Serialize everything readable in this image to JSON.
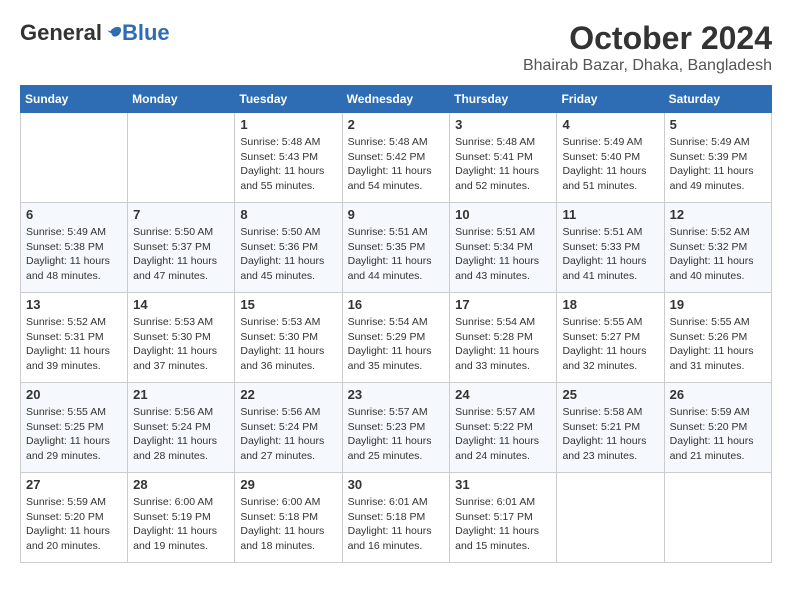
{
  "header": {
    "logo_general": "General",
    "logo_blue": "Blue",
    "month": "October 2024",
    "location": "Bhairab Bazar, Dhaka, Bangladesh"
  },
  "weekdays": [
    "Sunday",
    "Monday",
    "Tuesday",
    "Wednesday",
    "Thursday",
    "Friday",
    "Saturday"
  ],
  "weeks": [
    [
      {
        "day": "",
        "info": ""
      },
      {
        "day": "",
        "info": ""
      },
      {
        "day": "1",
        "info": "Sunrise: 5:48 AM\nSunset: 5:43 PM\nDaylight: 11 hours and 55 minutes."
      },
      {
        "day": "2",
        "info": "Sunrise: 5:48 AM\nSunset: 5:42 PM\nDaylight: 11 hours and 54 minutes."
      },
      {
        "day": "3",
        "info": "Sunrise: 5:48 AM\nSunset: 5:41 PM\nDaylight: 11 hours and 52 minutes."
      },
      {
        "day": "4",
        "info": "Sunrise: 5:49 AM\nSunset: 5:40 PM\nDaylight: 11 hours and 51 minutes."
      },
      {
        "day": "5",
        "info": "Sunrise: 5:49 AM\nSunset: 5:39 PM\nDaylight: 11 hours and 49 minutes."
      }
    ],
    [
      {
        "day": "6",
        "info": "Sunrise: 5:49 AM\nSunset: 5:38 PM\nDaylight: 11 hours and 48 minutes."
      },
      {
        "day": "7",
        "info": "Sunrise: 5:50 AM\nSunset: 5:37 PM\nDaylight: 11 hours and 47 minutes."
      },
      {
        "day": "8",
        "info": "Sunrise: 5:50 AM\nSunset: 5:36 PM\nDaylight: 11 hours and 45 minutes."
      },
      {
        "day": "9",
        "info": "Sunrise: 5:51 AM\nSunset: 5:35 PM\nDaylight: 11 hours and 44 minutes."
      },
      {
        "day": "10",
        "info": "Sunrise: 5:51 AM\nSunset: 5:34 PM\nDaylight: 11 hours and 43 minutes."
      },
      {
        "day": "11",
        "info": "Sunrise: 5:51 AM\nSunset: 5:33 PM\nDaylight: 11 hours and 41 minutes."
      },
      {
        "day": "12",
        "info": "Sunrise: 5:52 AM\nSunset: 5:32 PM\nDaylight: 11 hours and 40 minutes."
      }
    ],
    [
      {
        "day": "13",
        "info": "Sunrise: 5:52 AM\nSunset: 5:31 PM\nDaylight: 11 hours and 39 minutes."
      },
      {
        "day": "14",
        "info": "Sunrise: 5:53 AM\nSunset: 5:30 PM\nDaylight: 11 hours and 37 minutes."
      },
      {
        "day": "15",
        "info": "Sunrise: 5:53 AM\nSunset: 5:30 PM\nDaylight: 11 hours and 36 minutes."
      },
      {
        "day": "16",
        "info": "Sunrise: 5:54 AM\nSunset: 5:29 PM\nDaylight: 11 hours and 35 minutes."
      },
      {
        "day": "17",
        "info": "Sunrise: 5:54 AM\nSunset: 5:28 PM\nDaylight: 11 hours and 33 minutes."
      },
      {
        "day": "18",
        "info": "Sunrise: 5:55 AM\nSunset: 5:27 PM\nDaylight: 11 hours and 32 minutes."
      },
      {
        "day": "19",
        "info": "Sunrise: 5:55 AM\nSunset: 5:26 PM\nDaylight: 11 hours and 31 minutes."
      }
    ],
    [
      {
        "day": "20",
        "info": "Sunrise: 5:55 AM\nSunset: 5:25 PM\nDaylight: 11 hours and 29 minutes."
      },
      {
        "day": "21",
        "info": "Sunrise: 5:56 AM\nSunset: 5:24 PM\nDaylight: 11 hours and 28 minutes."
      },
      {
        "day": "22",
        "info": "Sunrise: 5:56 AM\nSunset: 5:24 PM\nDaylight: 11 hours and 27 minutes."
      },
      {
        "day": "23",
        "info": "Sunrise: 5:57 AM\nSunset: 5:23 PM\nDaylight: 11 hours and 25 minutes."
      },
      {
        "day": "24",
        "info": "Sunrise: 5:57 AM\nSunset: 5:22 PM\nDaylight: 11 hours and 24 minutes."
      },
      {
        "day": "25",
        "info": "Sunrise: 5:58 AM\nSunset: 5:21 PM\nDaylight: 11 hours and 23 minutes."
      },
      {
        "day": "26",
        "info": "Sunrise: 5:59 AM\nSunset: 5:20 PM\nDaylight: 11 hours and 21 minutes."
      }
    ],
    [
      {
        "day": "27",
        "info": "Sunrise: 5:59 AM\nSunset: 5:20 PM\nDaylight: 11 hours and 20 minutes."
      },
      {
        "day": "28",
        "info": "Sunrise: 6:00 AM\nSunset: 5:19 PM\nDaylight: 11 hours and 19 minutes."
      },
      {
        "day": "29",
        "info": "Sunrise: 6:00 AM\nSunset: 5:18 PM\nDaylight: 11 hours and 18 minutes."
      },
      {
        "day": "30",
        "info": "Sunrise: 6:01 AM\nSunset: 5:18 PM\nDaylight: 11 hours and 16 minutes."
      },
      {
        "day": "31",
        "info": "Sunrise: 6:01 AM\nSunset: 5:17 PM\nDaylight: 11 hours and 15 minutes."
      },
      {
        "day": "",
        "info": ""
      },
      {
        "day": "",
        "info": ""
      }
    ]
  ]
}
